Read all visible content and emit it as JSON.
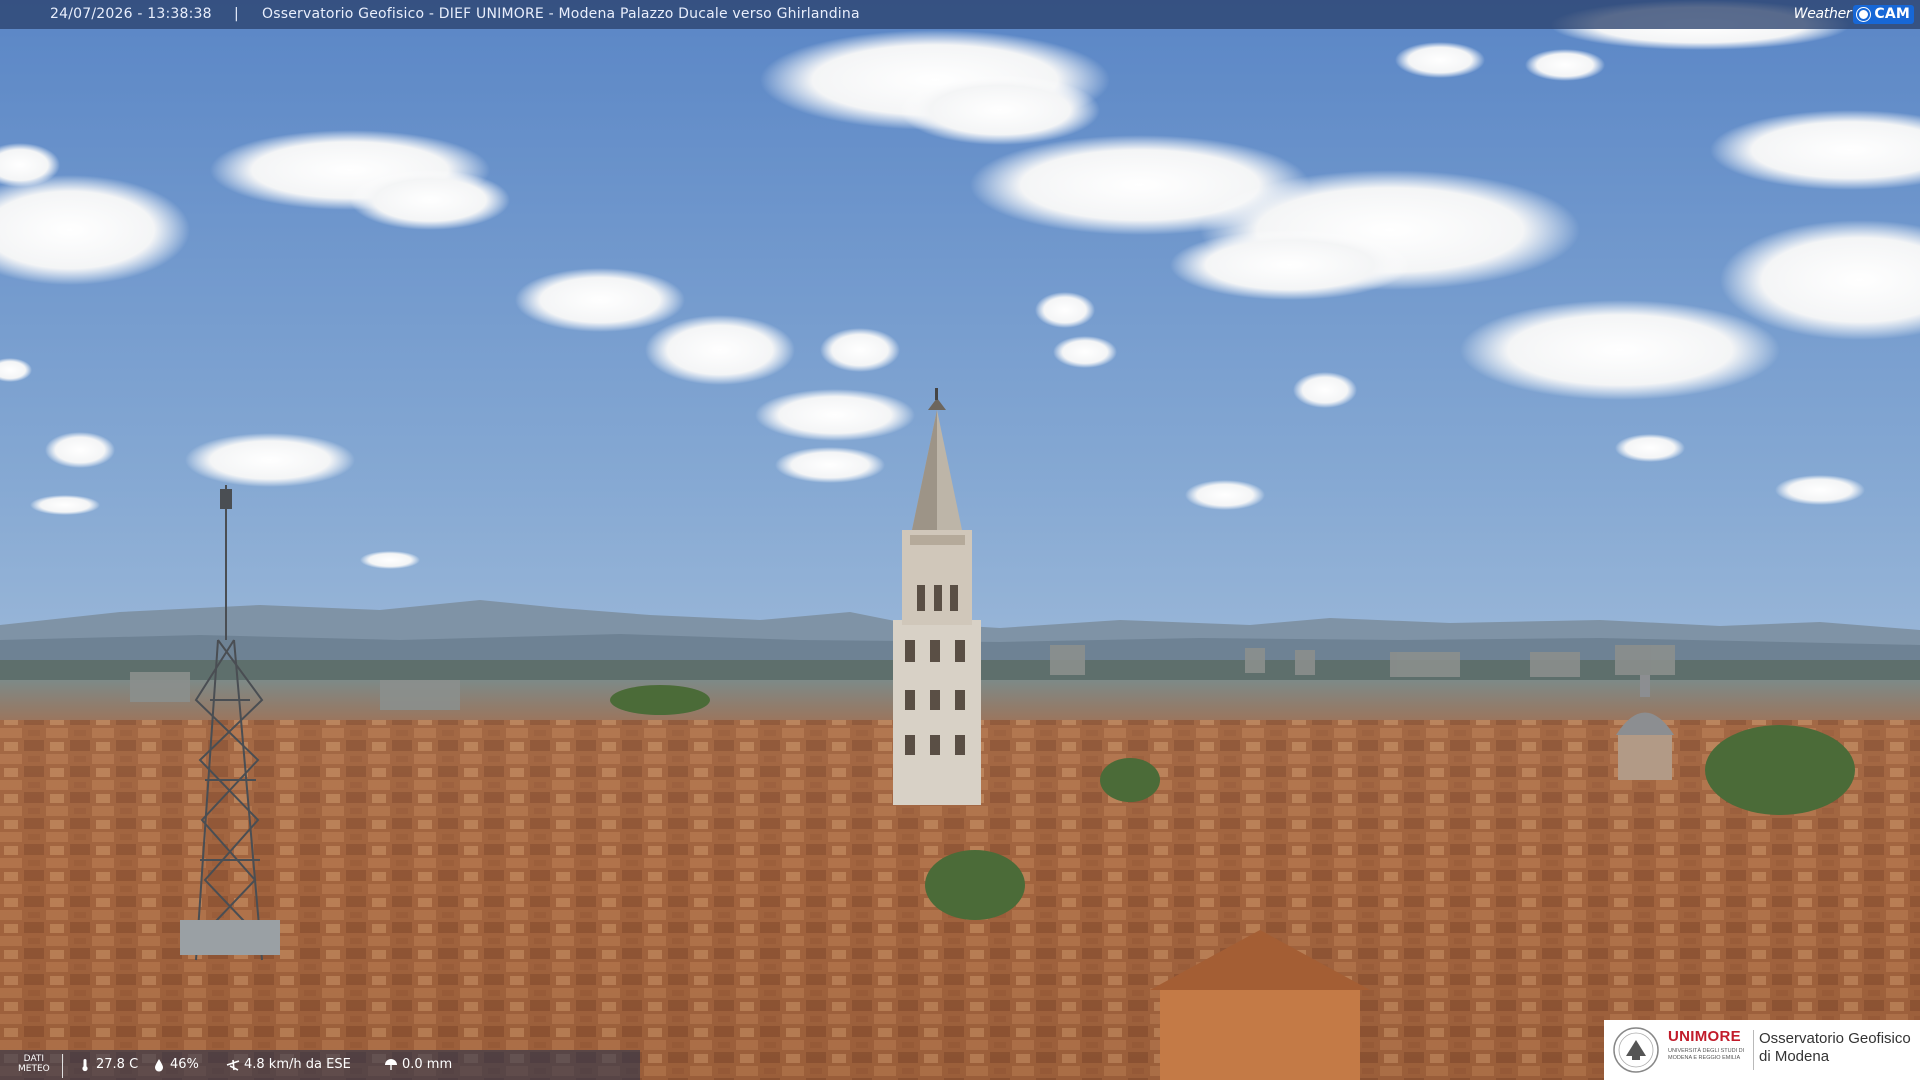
{
  "header": {
    "timestamp": "24/07/2026 - 13:38:38",
    "separator": "|",
    "title": "Osservatorio Geofisico - DIEF UNIMORE - Modena Palazzo Ducale verso Ghirlandina"
  },
  "brand": {
    "weather": "Weather",
    "cam": "CAM"
  },
  "weather_bar": {
    "dati_line1": "DATI",
    "dati_line2": "METEO",
    "temperature": "27.8 C",
    "humidity": "46%",
    "wind": "4.8 km/h da ESE",
    "rain": "0.0 mm"
  },
  "logo": {
    "name_red": "UNIMORE",
    "subtext": "UNIVERSITÀ DEGLI STUDI DI MODENA E REGGIO EMILIA",
    "observatory_line1": "Osservatorio Geofisico",
    "observatory_line2": "di Modena"
  },
  "colors": {
    "sky_top": "#4f7fc2",
    "sky_bottom": "#b8cde2",
    "mountains": "#6f8497",
    "roofs": "#a56a43",
    "tower": "#d9d3c8",
    "brand_blue": "#1767d6",
    "unimore_red": "#c11b2a"
  }
}
